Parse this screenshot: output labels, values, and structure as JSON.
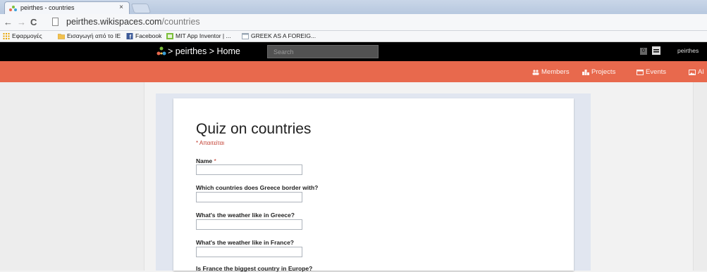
{
  "browser": {
    "tab_title": "peirthes - countries",
    "tab_close": "×",
    "url_host": "peirthes.wikispaces.com",
    "url_path": "/countries",
    "nav_back": "←",
    "nav_forward": "→",
    "nav_reload": "C"
  },
  "bookmarks": [
    {
      "label": "Εφαρμογές",
      "icon": "apps-grid-icon",
      "color": "#e8a500"
    },
    {
      "label": "Εισαγωγή από το IE",
      "icon": "folder-icon",
      "color": "#f2c14e"
    },
    {
      "label": "Facebook",
      "icon": "facebook-icon",
      "color": "#3b5998"
    },
    {
      "label": "MIT App Inventor | ...",
      "icon": "mit-icon",
      "color": "#7bbf3a"
    },
    {
      "label": "GREEK AS A FOREIG...",
      "icon": "page-icon",
      "color": "#9aa7b5"
    }
  ],
  "site": {
    "breadcrumb": "> peirthes > Home",
    "search_placeholder": "Search",
    "notifications_count": "0",
    "user": "peirthes"
  },
  "orange_nav": [
    {
      "label": "Members",
      "icon": "members-icon"
    },
    {
      "label": "Projects",
      "icon": "projects-icon"
    },
    {
      "label": "Events",
      "icon": "calendar-icon"
    },
    {
      "label": "Al",
      "icon": "image-icon"
    }
  ],
  "form": {
    "title": "Quiz on countries",
    "required_note": "* Απαιτείται",
    "questions": [
      {
        "label": "Name",
        "required": "*"
      },
      {
        "label": "Which countries does Greece border with?",
        "required": ""
      },
      {
        "label": "What's the weather like in Greece?",
        "required": ""
      },
      {
        "label": "What's the weather like in France?",
        "required": ""
      },
      {
        "label": "Is France the biggest country in Europe?",
        "required": ""
      }
    ]
  },
  "colors": {
    "accent_orange": "#e8694d",
    "header_black": "#000000",
    "required_red": "#c0392b"
  }
}
